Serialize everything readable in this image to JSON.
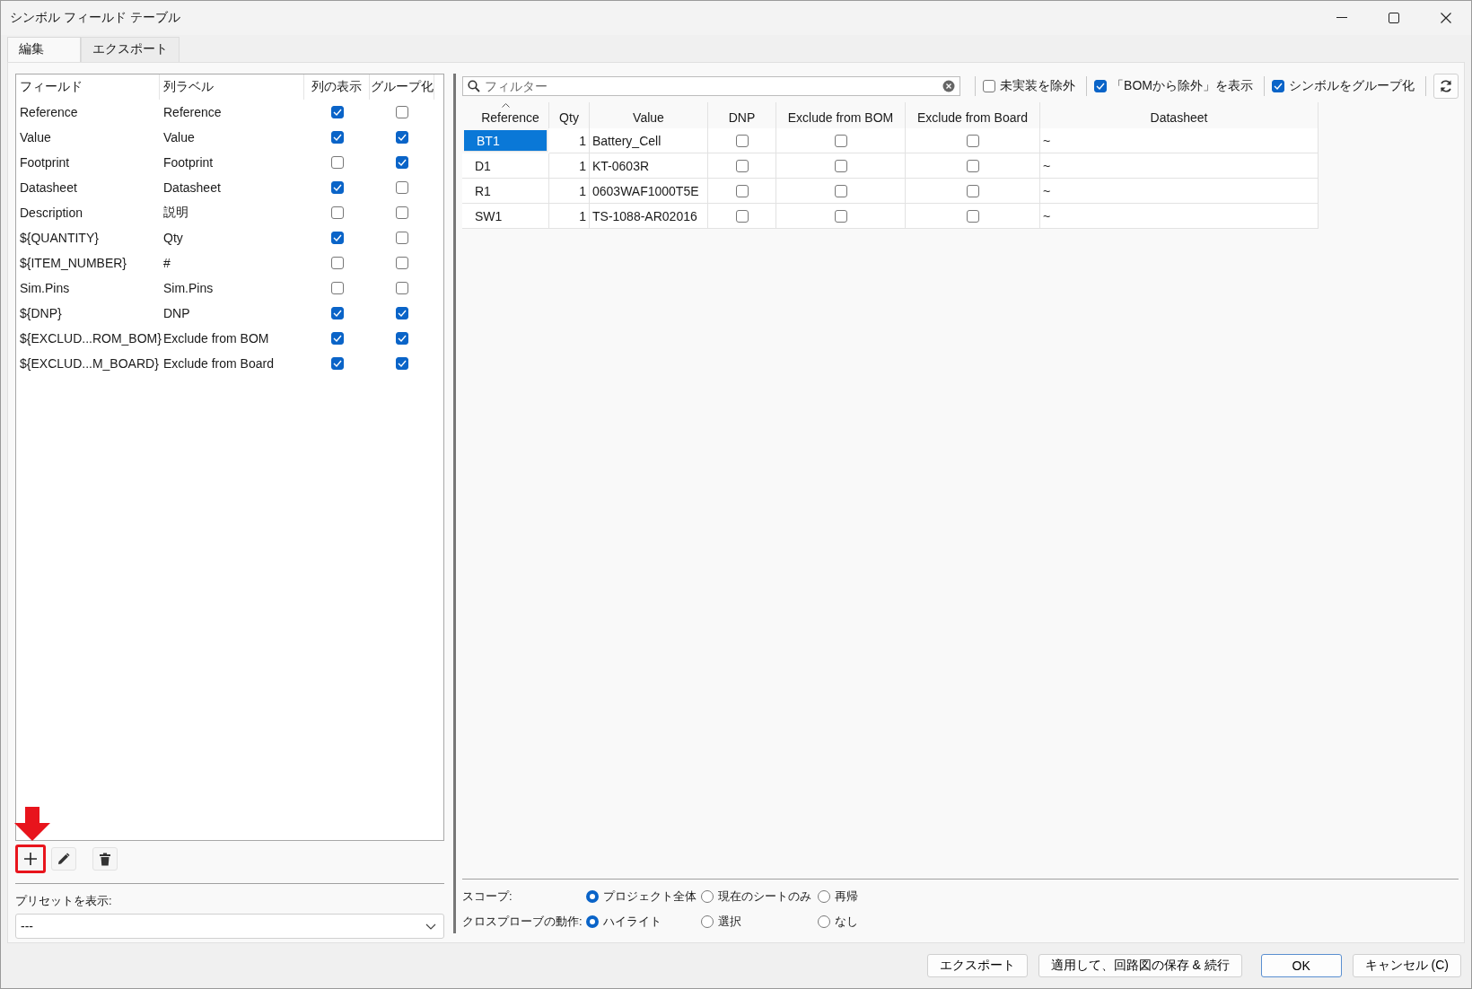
{
  "window": {
    "title": "シンボル フィールド テーブル"
  },
  "tabs": [
    {
      "label": "編集",
      "selected": true
    },
    {
      "label": "エクスポート",
      "selected": false
    }
  ],
  "fields_table": {
    "columns": [
      "フィールド",
      "列ラベル",
      "列の表示",
      "グループ化"
    ],
    "rows": [
      {
        "field": "Reference",
        "label": "Reference",
        "show": true,
        "group": false
      },
      {
        "field": "Value",
        "label": "Value",
        "show": true,
        "group": true
      },
      {
        "field": "Footprint",
        "label": "Footprint",
        "show": false,
        "group": true
      },
      {
        "field": "Datasheet",
        "label": "Datasheet",
        "show": true,
        "group": false
      },
      {
        "field": "Description",
        "label": "説明",
        "show": false,
        "group": false
      },
      {
        "field": "${QUANTITY}",
        "label": "Qty",
        "show": true,
        "group": false
      },
      {
        "field": "${ITEM_NUMBER}",
        "label": "#",
        "show": false,
        "group": false
      },
      {
        "field": "Sim.Pins",
        "label": "Sim.Pins",
        "show": false,
        "group": false
      },
      {
        "field": "${DNP}",
        "label": "DNP",
        "show": true,
        "group": true
      },
      {
        "field": "${EXCLUD...ROM_BOM}",
        "label": "Exclude from BOM",
        "show": true,
        "group": true
      },
      {
        "field": "${EXCLUD...M_BOARD}",
        "label": "Exclude from Board",
        "show": true,
        "group": true
      }
    ]
  },
  "field_buttons": [
    {
      "kind": "add",
      "highlighted": true
    },
    {
      "kind": "edit",
      "highlighted": false
    },
    {
      "kind": "delete",
      "highlighted": false
    }
  ],
  "preset": {
    "label": "プリセットを表示:",
    "value": "---"
  },
  "filter": {
    "placeholder": "フィルター"
  },
  "options": [
    {
      "label": "未実装を除外",
      "checked": false
    },
    {
      "label": "「BOMから除外」を表示",
      "checked": true
    },
    {
      "label": "シンボルをグループ化",
      "checked": true
    }
  ],
  "grid": {
    "columns": [
      {
        "label": "Reference",
        "sorted": true
      },
      {
        "label": "Qty",
        "sorted": false
      },
      {
        "label": "Value",
        "sorted": false
      },
      {
        "label": "DNP",
        "sorted": false
      },
      {
        "label": "Exclude from BOM",
        "sorted": false
      },
      {
        "label": "Exclude from Board",
        "sorted": false
      },
      {
        "label": "Datasheet",
        "sorted": false
      }
    ],
    "rows": [
      {
        "reference": "BT1",
        "qty": "1",
        "value": "Battery_Cell",
        "dnp": false,
        "exclude_bom": false,
        "exclude_board": false,
        "datasheet": "~",
        "selected": true
      },
      {
        "reference": "D1",
        "qty": "1",
        "value": "KT-0603R",
        "dnp": false,
        "exclude_bom": false,
        "exclude_board": false,
        "datasheet": "~",
        "selected": false
      },
      {
        "reference": "R1",
        "qty": "1",
        "value": "0603WAF1000T5E",
        "dnp": false,
        "exclude_bom": false,
        "exclude_board": false,
        "datasheet": "~",
        "selected": false
      },
      {
        "reference": "SW1",
        "qty": "1",
        "value": "TS-1088-AR02016",
        "dnp": false,
        "exclude_bom": false,
        "exclude_board": false,
        "datasheet": "~",
        "selected": false
      }
    ]
  },
  "scope": {
    "label": "スコープ:",
    "options": [
      {
        "label": "プロジェクト全体",
        "selected": true
      },
      {
        "label": "現在のシートのみ",
        "selected": false
      },
      {
        "label": "再帰",
        "selected": false
      }
    ]
  },
  "crossprobe": {
    "label": "クロスプローブの動作:",
    "options": [
      {
        "label": "ハイライト",
        "selected": true
      },
      {
        "label": "選択",
        "selected": false
      },
      {
        "label": "なし",
        "selected": false
      }
    ]
  },
  "buttons": [
    {
      "label": "エクスポート",
      "kind": "normal"
    },
    {
      "label": "適用して、回路図の保存 & 続行",
      "kind": "normal"
    },
    {
      "label": "OK",
      "kind": "default"
    },
    {
      "label": "キャンセル (C)",
      "kind": "normal"
    }
  ]
}
